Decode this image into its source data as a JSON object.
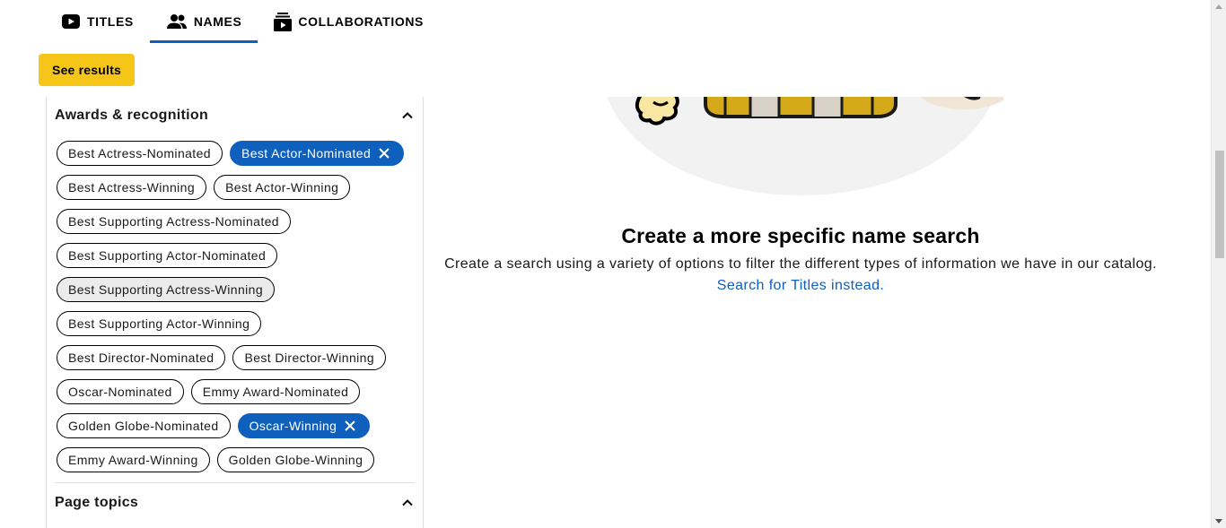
{
  "tabs": [
    {
      "label": "TITLES",
      "icon": "video-play-icon",
      "active": false
    },
    {
      "label": "NAMES",
      "icon": "people-icon",
      "active": true
    },
    {
      "label": "COLLABORATIONS",
      "icon": "collaborations-icon",
      "active": false
    }
  ],
  "see_results_label": "See results",
  "awards_section": {
    "title": "Awards & recognition",
    "expanded": true,
    "chips": [
      {
        "label": "Best Actress-Nominated",
        "selected": false
      },
      {
        "label": "Best Actor-Nominated",
        "selected": true
      },
      {
        "label": "Best Actress-Winning",
        "selected": false
      },
      {
        "label": "Best Actor-Winning",
        "selected": false
      },
      {
        "label": "Best Supporting Actress-Nominated",
        "selected": false
      },
      {
        "label": "Best Supporting Actor-Nominated",
        "selected": false
      },
      {
        "label": "Best Supporting Actress-Winning",
        "selected": false,
        "hovered": true
      },
      {
        "label": "Best Supporting Actor-Winning",
        "selected": false
      },
      {
        "label": "Best Director-Nominated",
        "selected": false
      },
      {
        "label": "Best Director-Winning",
        "selected": false
      },
      {
        "label": "Oscar-Nominated",
        "selected": false
      },
      {
        "label": "Emmy Award-Nominated",
        "selected": false
      },
      {
        "label": "Golden Globe-Nominated",
        "selected": false
      },
      {
        "label": "Oscar-Winning",
        "selected": true
      },
      {
        "label": "Emmy Award-Winning",
        "selected": false
      },
      {
        "label": "Golden Globe-Winning",
        "selected": false
      }
    ]
  },
  "page_topics_section": {
    "title": "Page topics",
    "expanded": true
  },
  "empty_state": {
    "headline": "Create a more specific name search",
    "description": "Create a search using a variety of options to filter the different types of information we have in our catalog.",
    "link_text": "Search for Titles instead."
  },
  "colors": {
    "accent_yellow": "#f5c518",
    "selected_blue": "#0f5fbd",
    "link_blue": "#0f5fbd"
  }
}
